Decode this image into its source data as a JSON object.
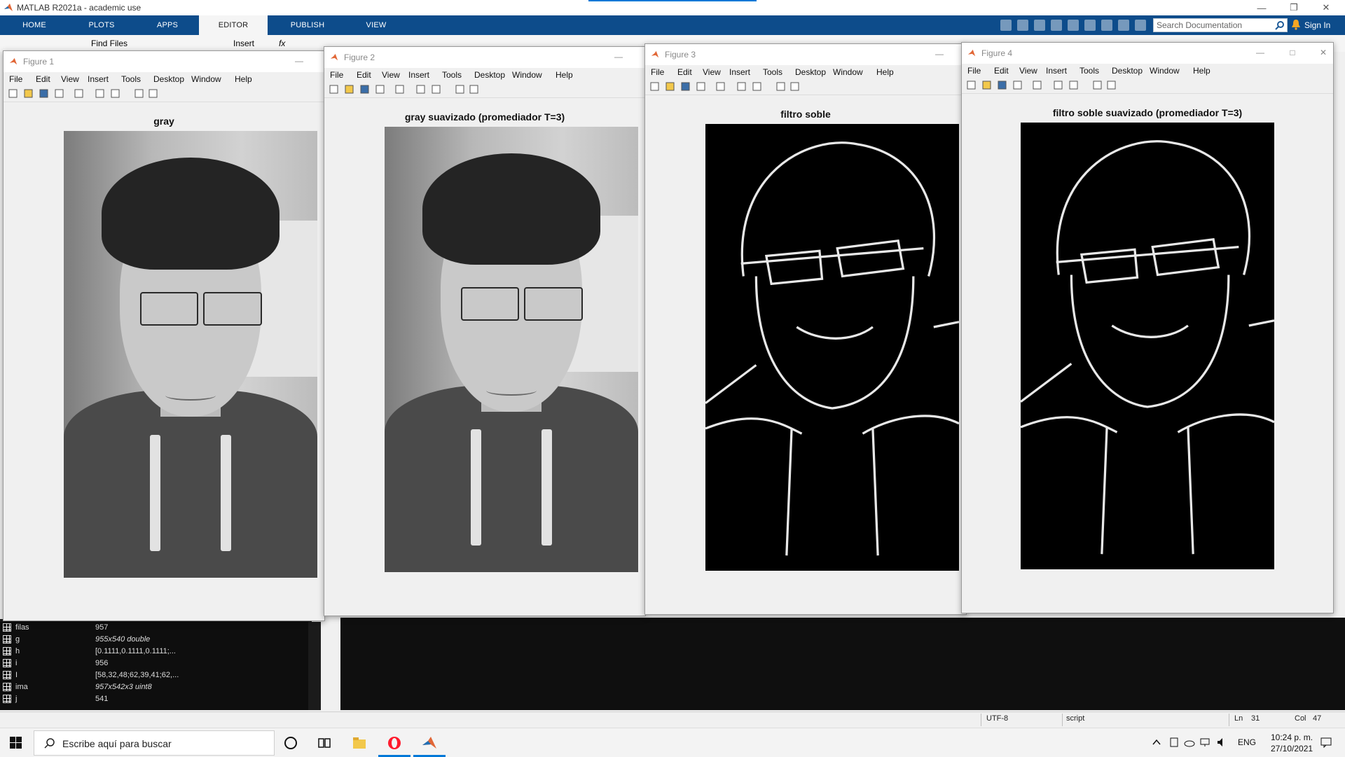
{
  "app": {
    "title": "MATLAB R2021a - academic use"
  },
  "ribbon": {
    "tabs": [
      "HOME",
      "PLOTS",
      "APPS",
      "EDITOR",
      "PUBLISH",
      "VIEW"
    ],
    "search_placeholder": "Search Documentation",
    "sign_in": "Sign In"
  },
  "toolstrip": {
    "find_files": "Find Files",
    "insert": "Insert",
    "fx": "fx"
  },
  "figure_menu": [
    "File",
    "Edit",
    "View",
    "Insert",
    "Tools",
    "Desktop",
    "Window",
    "Help"
  ],
  "figures": [
    {
      "window_title": "Figure 1",
      "plot_title": "gray"
    },
    {
      "window_title": "Figure 2",
      "plot_title": "gray suavizado (promediador T=3)"
    },
    {
      "window_title": "Figure 3",
      "plot_title": "filtro soble"
    },
    {
      "window_title": "Figure 4",
      "plot_title": "filtro soble suavizado (promediador T=3)"
    }
  ],
  "workspace": {
    "variables": [
      {
        "name": "filas",
        "value": "957",
        "italic": false
      },
      {
        "name": "g",
        "value": "955x540 double",
        "italic": true
      },
      {
        "name": "h",
        "value": "[0.1111,0.1111,0.1111;...",
        "italic": false
      },
      {
        "name": "i",
        "value": "956",
        "italic": false
      },
      {
        "name": "I",
        "value": "[58,32,48;62,39,41;62,...",
        "italic": false
      },
      {
        "name": "ima",
        "value": "957x542x3 uint8",
        "italic": true
      },
      {
        "name": "j",
        "value": "541",
        "italic": false
      }
    ]
  },
  "statusbar": {
    "encoding": "UTF-8",
    "type": "script",
    "ln_label": "Ln",
    "ln": "31",
    "col_label": "Col",
    "col": "47"
  },
  "taskbar": {
    "search_placeholder": "Escribe aquí para buscar",
    "lang": "ENG",
    "time": "10:24 p. m.",
    "date": "27/10/2021"
  },
  "colors": {
    "ribbon": "#0d4c8b",
    "accent": "#0078d7"
  }
}
